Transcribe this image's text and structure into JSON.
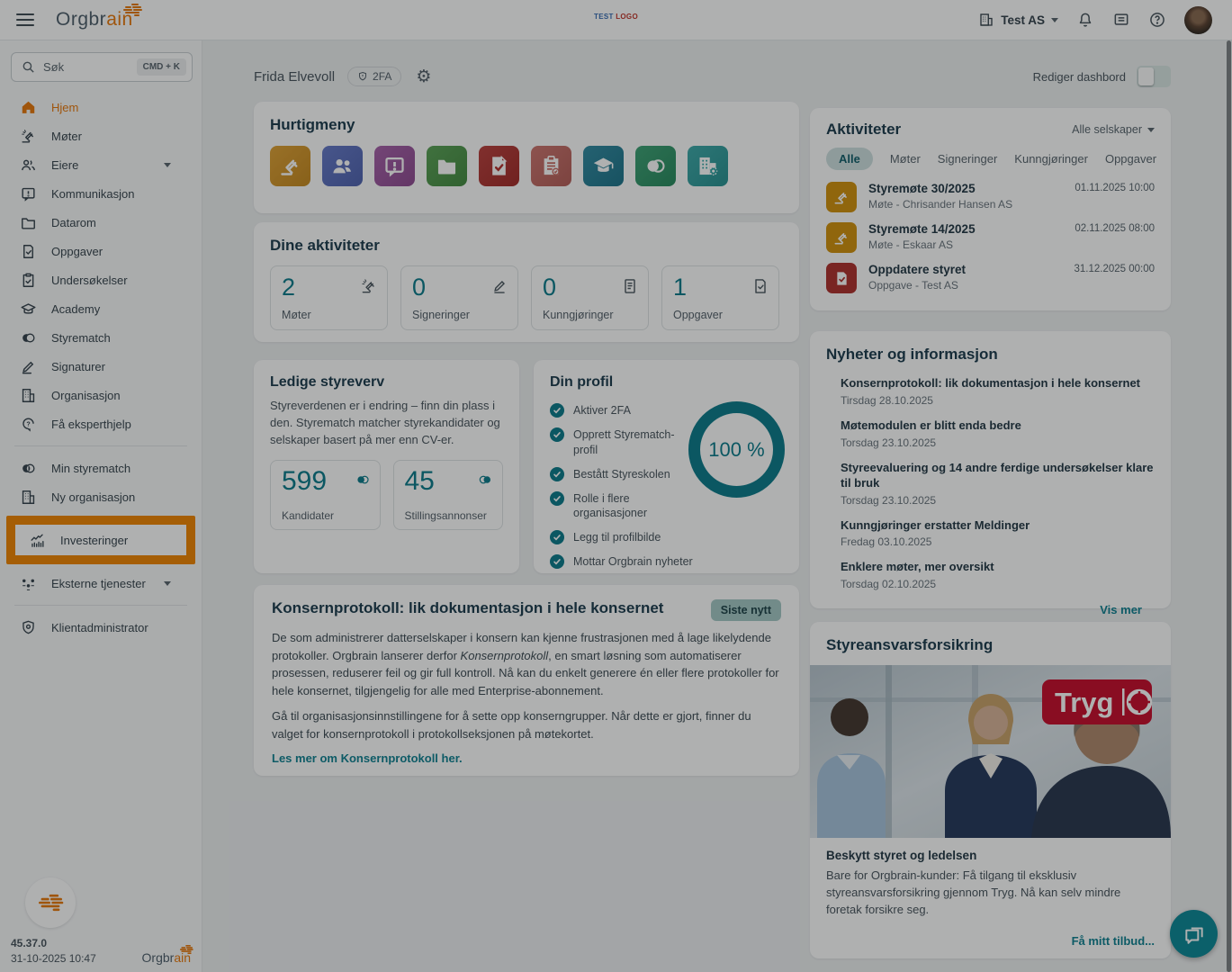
{
  "topbar": {
    "app_name": "Orgbrain",
    "center_logo": {
      "part1": "TEST",
      "part2": "LOGO"
    },
    "company": "Test AS"
  },
  "sidebar": {
    "search": {
      "placeholder": "Søk",
      "shortcut": "CMD + K"
    },
    "items": [
      {
        "label": "Hjem",
        "icon": "home-icon",
        "active": true
      },
      {
        "label": "Møter",
        "icon": "gavel-icon"
      },
      {
        "label": "Eiere",
        "icon": "owners-icon",
        "expandable": true
      },
      {
        "label": "Kommunikasjon",
        "icon": "chat-alert-icon"
      },
      {
        "label": "Datarom",
        "icon": "folder-icon"
      },
      {
        "label": "Oppgaver",
        "icon": "task-icon"
      },
      {
        "label": "Undersøkelser",
        "icon": "clipboard-check-icon"
      },
      {
        "label": "Academy",
        "icon": "graduation-icon"
      },
      {
        "label": "Styrematch",
        "icon": "venn-icon"
      },
      {
        "label": "Signaturer",
        "icon": "pen-icon"
      },
      {
        "label": "Organisasjon",
        "icon": "building-icon"
      },
      {
        "label": "Få eksperthjelp",
        "icon": "expert-help-icon"
      },
      {
        "label": "Min styrematch",
        "icon": "venn-icon"
      },
      {
        "label": "Ny organisasjon",
        "icon": "building-icon"
      },
      {
        "label": "Investeringer",
        "icon": "chart-icon",
        "highlighted": true
      },
      {
        "label": "Eksterne tjenester",
        "icon": "network-icon",
        "expandable": true
      },
      {
        "label": "Klientadministrator",
        "icon": "shield-icon"
      }
    ],
    "footer": {
      "version": "45.37.0",
      "datetime": "31-10-2025 10:47",
      "logo": "Orgbrain"
    }
  },
  "header": {
    "user_name": "Frida Elvevoll",
    "badge_2fa": "2FA",
    "edit_dashboard_label": "Rediger dashbord",
    "edit_dashboard_on": false
  },
  "main": {
    "hurtigmeny": {
      "title": "Hurtigmeny",
      "tiles": [
        {
          "icon": "gavel-icon",
          "color": "#DC9A26"
        },
        {
          "icon": "owners-icon",
          "color": "#5A6FC4"
        },
        {
          "icon": "chat-alert-icon",
          "color": "#A055A3"
        },
        {
          "icon": "folder-icon",
          "color": "#4E9B4A"
        },
        {
          "icon": "task-icon",
          "color": "#B5322F"
        },
        {
          "icon": "clipboard-check-icon",
          "color": "#C96A64"
        },
        {
          "icon": "graduation-icon",
          "color": "#23829B"
        },
        {
          "icon": "venn-icon",
          "color": "#2F9B6B"
        },
        {
          "icon": "building-gear-icon",
          "color": "#2FA3A3"
        }
      ]
    },
    "activities": {
      "title": "Dine aktiviteter",
      "stats": [
        {
          "value": "2",
          "label": "Møter",
          "icon": "gavel-icon"
        },
        {
          "value": "0",
          "label": "Signeringer",
          "icon": "pen-icon"
        },
        {
          "value": "0",
          "label": "Kunngjøringer",
          "icon": "document-icon"
        },
        {
          "value": "1",
          "label": "Oppgaver",
          "icon": "task-icon"
        }
      ]
    },
    "styreverv": {
      "title": "Ledige styreverv",
      "body": "Styreverdenen er i endring – finn din plass i den. Styrematch matcher styrekandidater og selskaper basert på mer enn CV-er.",
      "stats": [
        {
          "value": "599",
          "label": "Kandidater",
          "icon": "venn-icon"
        },
        {
          "value": "45",
          "label": "Stillingsannonser",
          "icon": "venn-icon"
        }
      ]
    },
    "profile": {
      "title": "Din profil",
      "progress": "100 %",
      "items": [
        "Aktiver 2FA",
        "Opprett Styrematch-profil",
        "Bestått Styreskolen",
        "Rolle i flere organisasjoner",
        "Legg til profilbilde",
        "Mottar Orgbrain nyheter"
      ]
    },
    "konsern": {
      "title": "Konsernprotokoll: lik dokumentasjon i hele konsernet",
      "badge": "Siste nytt",
      "p1_before": "De som administrerer datterselskaper i konsern kan kjenne frustrasjonen med å lage likelydende protokoller. Orgbrain lanserer derfor ",
      "p1_italic": "Konsernprotokoll",
      "p1_after": ", en smart løsning som automatiserer prosessen, reduserer feil og gir full kontroll. Nå kan du enkelt generere én eller flere protokoller for hele konsernet, tilgjengelig for alle med Enterprise-abonnement.",
      "p2": "Gå til organisasjonsinnstillingene for å sette opp konserngrupper. Når dette er gjort, finner du valget for konsernprotokoll i protokollseksjonen på møtekortet.",
      "link": "Les mer om Konsernprotokoll her."
    }
  },
  "right": {
    "aktiviteter": {
      "title": "Aktiviteter",
      "filter": "Alle selskaper",
      "tabs": [
        "Alle",
        "Møter",
        "Signeringer",
        "Kunngjøringer",
        "Oppgaver"
      ],
      "selected_tab": "Alle",
      "items": [
        {
          "icon": "gavel-icon",
          "title": "Styremøte 30/2025",
          "subtitle": "Møte - Chrisander Hansen AS",
          "datetime": "01.11.2025 10:00"
        },
        {
          "icon": "gavel-icon",
          "title": "Styremøte 14/2025",
          "subtitle": "Møte - Eskaar AS",
          "datetime": "02.11.2025 08:00"
        },
        {
          "icon": "task-icon",
          "title": "Oppdatere styret",
          "subtitle": "Oppgave - Test AS",
          "datetime": "31.12.2025 00:00"
        }
      ]
    },
    "nyheter": {
      "title": "Nyheter og informasjon",
      "items": [
        {
          "title": "Konsernprotokoll: lik dokumentasjon i hele konsernet",
          "date": "Tirsdag 28.10.2025"
        },
        {
          "title": "Møtemodulen er blitt enda bedre",
          "date": "Torsdag 23.10.2025"
        },
        {
          "title": "Styreevaluering og 14 andre ferdige undersøkelser klare til bruk",
          "date": "Torsdag 23.10.2025"
        },
        {
          "title": "Kunngjøringer erstatter Meldinger",
          "date": "Fredag 03.10.2025"
        },
        {
          "title": "Enklere møter, mer oversikt",
          "date": "Torsdag 02.10.2025"
        }
      ],
      "more": "Vis mer"
    },
    "forsikring": {
      "title": "Styreansvarsforsikring",
      "brand": "Tryg",
      "heading": "Beskytt styret og ledelsen",
      "body": "Bare for Orgbrain-kunder: Få tilgang til eksklusiv styreansvarsforsikring gjennom Tryg. Nå kan selv mindre foretak forsikre seg.",
      "link": "Få mitt tilbud..."
    }
  },
  "colors": {
    "accent_teal": "#0E7D8C",
    "brand_orange": "#E8790E",
    "highlight_border": "#F08705",
    "tryg_red": "#C8102E"
  }
}
